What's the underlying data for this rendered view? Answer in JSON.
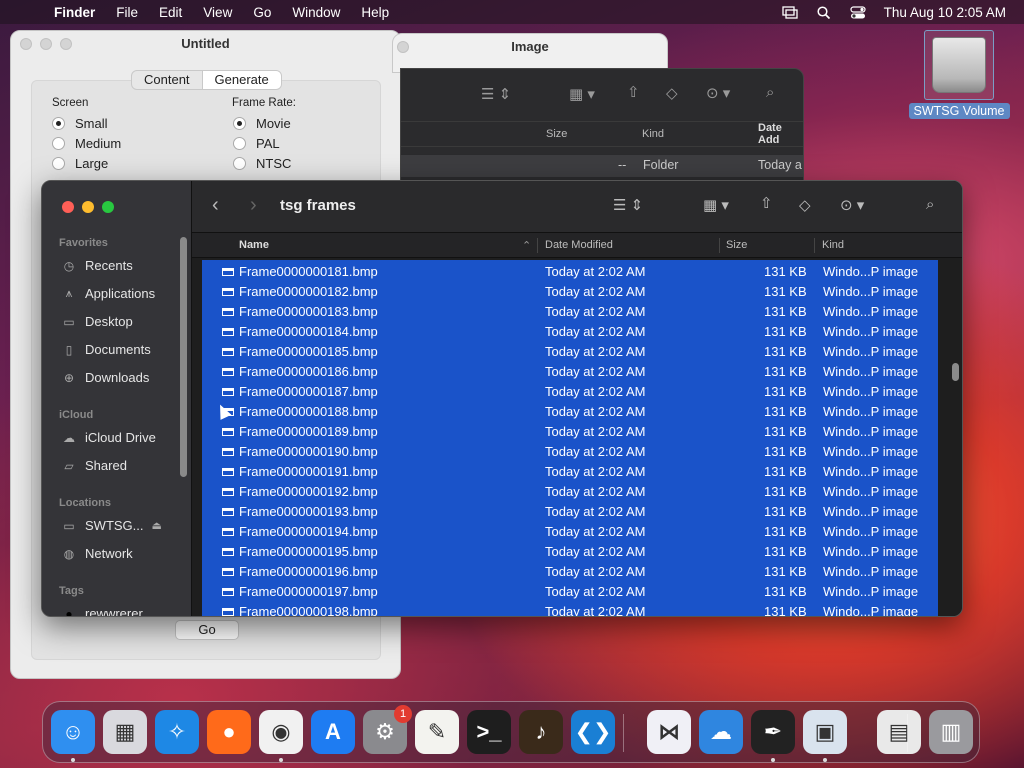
{
  "menubar": {
    "app_name": "Finder",
    "items": [
      "File",
      "Edit",
      "View",
      "Go",
      "Window",
      "Help"
    ],
    "clock": "Thu Aug 10  2:05 AM"
  },
  "desktop": {
    "volume_label": "SWTSG Volume"
  },
  "untitled_window": {
    "title": "Untitled",
    "tabs": [
      "Content",
      "Generate"
    ],
    "selected_tab": "Generate",
    "screen_label": "Screen",
    "screen_options": [
      "Small",
      "Medium",
      "Large"
    ],
    "screen_selected": "Small",
    "frame_rate_label": "Frame Rate:",
    "frame_rate_options": [
      "Movie",
      "PAL",
      "NTSC"
    ],
    "frame_rate_selected": "Movie",
    "go_label": "Go"
  },
  "image_window": {
    "title": "Image",
    "columns": [
      "Size",
      "Kind",
      "Date Add"
    ],
    "row": {
      "size": "--",
      "kind": "Folder",
      "date": "Today a"
    }
  },
  "finder": {
    "title": "tsg frames",
    "sidebar": {
      "favorites_label": "Favorites",
      "favorites": [
        {
          "label": "Recents",
          "icon": "clock-icon"
        },
        {
          "label": "Applications",
          "icon": "applications-icon"
        },
        {
          "label": "Desktop",
          "icon": "desktop-icon"
        },
        {
          "label": "Documents",
          "icon": "document-icon"
        },
        {
          "label": "Downloads",
          "icon": "download-icon"
        }
      ],
      "icloud_label": "iCloud",
      "icloud": [
        {
          "label": "iCloud Drive",
          "icon": "cloud-icon"
        },
        {
          "label": "Shared",
          "icon": "shared-folder-icon"
        }
      ],
      "locations_label": "Locations",
      "locations": [
        {
          "label": "SWTSG...",
          "icon": "drive-icon"
        },
        {
          "label": "Network",
          "icon": "network-icon"
        }
      ],
      "tags_label": "Tags",
      "tags": [
        {
          "label": "rewwrerer"
        }
      ]
    },
    "columns": {
      "name": "Name",
      "date": "Date Modified",
      "size": "Size",
      "kind": "Kind"
    },
    "files": [
      {
        "name": "Frame0000000181.bmp",
        "date": "Today at 2:02 AM",
        "size": "131 KB",
        "kind": "Windo...P image"
      },
      {
        "name": "Frame0000000182.bmp",
        "date": "Today at 2:02 AM",
        "size": "131 KB",
        "kind": "Windo...P image"
      },
      {
        "name": "Frame0000000183.bmp",
        "date": "Today at 2:02 AM",
        "size": "131 KB",
        "kind": "Windo...P image"
      },
      {
        "name": "Frame0000000184.bmp",
        "date": "Today at 2:02 AM",
        "size": "131 KB",
        "kind": "Windo...P image"
      },
      {
        "name": "Frame0000000185.bmp",
        "date": "Today at 2:02 AM",
        "size": "131 KB",
        "kind": "Windo...P image"
      },
      {
        "name": "Frame0000000186.bmp",
        "date": "Today at 2:02 AM",
        "size": "131 KB",
        "kind": "Windo...P image"
      },
      {
        "name": "Frame0000000187.bmp",
        "date": "Today at 2:02 AM",
        "size": "131 KB",
        "kind": "Windo...P image"
      },
      {
        "name": "Frame0000000188.bmp",
        "date": "Today at 2:02 AM",
        "size": "131 KB",
        "kind": "Windo...P image"
      },
      {
        "name": "Frame0000000189.bmp",
        "date": "Today at 2:02 AM",
        "size": "131 KB",
        "kind": "Windo...P image"
      },
      {
        "name": "Frame0000000190.bmp",
        "date": "Today at 2:02 AM",
        "size": "131 KB",
        "kind": "Windo...P image"
      },
      {
        "name": "Frame0000000191.bmp",
        "date": "Today at 2:02 AM",
        "size": "131 KB",
        "kind": "Windo...P image"
      },
      {
        "name": "Frame0000000192.bmp",
        "date": "Today at 2:02 AM",
        "size": "131 KB",
        "kind": "Windo...P image"
      },
      {
        "name": "Frame0000000193.bmp",
        "date": "Today at 2:02 AM",
        "size": "131 KB",
        "kind": "Windo...P image"
      },
      {
        "name": "Frame0000000194.bmp",
        "date": "Today at 2:02 AM",
        "size": "131 KB",
        "kind": "Windo...P image"
      },
      {
        "name": "Frame0000000195.bmp",
        "date": "Today at 2:02 AM",
        "size": "131 KB",
        "kind": "Windo...P image"
      },
      {
        "name": "Frame0000000196.bmp",
        "date": "Today at 2:02 AM",
        "size": "131 KB",
        "kind": "Windo...P image"
      },
      {
        "name": "Frame0000000197.bmp",
        "date": "Today at 2:02 AM",
        "size": "131 KB",
        "kind": "Windo...P image"
      },
      {
        "name": "Frame0000000198.bmp",
        "date": "Today at 2:02 AM",
        "size": "131 KB",
        "kind": "Windo...P image"
      }
    ]
  },
  "dock": {
    "apps": [
      {
        "name": "finder",
        "color": "#2f8ff0",
        "glyph": "☺",
        "running": true
      },
      {
        "name": "launchpad",
        "color": "#d9d9de",
        "glyph": "▦",
        "running": false
      },
      {
        "name": "safari",
        "color": "#1e88e5",
        "glyph": "✧",
        "running": false
      },
      {
        "name": "firefox",
        "color": "#ff6a1a",
        "glyph": "●",
        "running": false
      },
      {
        "name": "chrome",
        "color": "#f1f1f1",
        "glyph": "◉",
        "running": true
      },
      {
        "name": "app-store",
        "color": "#1e7cf2",
        "glyph": "A",
        "running": false
      },
      {
        "name": "system-settings",
        "color": "#8a8a8e",
        "glyph": "⚙",
        "running": false,
        "badge": "1"
      },
      {
        "name": "textedit",
        "color": "#f3f3ef",
        "glyph": "✎",
        "running": false
      },
      {
        "name": "terminal",
        "color": "#1e1e1e",
        "glyph": ">_",
        "running": false
      },
      {
        "name": "garageband",
        "color": "#3a2a1a",
        "glyph": "♪",
        "running": false
      },
      {
        "name": "visual-studio-code",
        "color": "#1a7fd4",
        "glyph": "❮❯",
        "running": false
      },
      {
        "name": "visual-studio",
        "color": "#f0f0f6",
        "glyph": "⋈",
        "running": false
      },
      {
        "name": "weather",
        "color": "#2f86e0",
        "glyph": "☁",
        "running": false
      },
      {
        "name": "script-editor",
        "color": "#222222",
        "glyph": "✒",
        "running": true
      },
      {
        "name": "preview",
        "color": "#d9e3ee",
        "glyph": "▣",
        "running": true
      },
      {
        "name": "downloads-stack",
        "color": "#e9e9e9",
        "glyph": "▤",
        "running": false
      },
      {
        "name": "trash",
        "color": "#9a9a9e",
        "glyph": "▥",
        "running": false
      }
    ]
  }
}
